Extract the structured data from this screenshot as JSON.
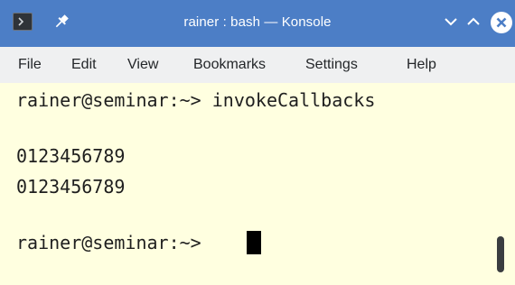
{
  "window": {
    "title": "rainer : bash — Konsole",
    "titlebar_color": "#4c7ec6"
  },
  "menu": {
    "items": [
      "File",
      "Edit",
      "View",
      "Bookmarks",
      "Settings",
      "Help"
    ]
  },
  "terminal": {
    "background": "#ffffe0",
    "lines": [
      "rainer@seminar:~> invokeCallbacks",
      "",
      "0123456789",
      "0123456789",
      "",
      "rainer@seminar:~> "
    ]
  },
  "icons": {
    "app": "konsole-terminal-icon",
    "pin": "pin-icon",
    "minimize": "chevron-down-icon",
    "maximize": "chevron-up-icon",
    "close": "close-icon"
  }
}
